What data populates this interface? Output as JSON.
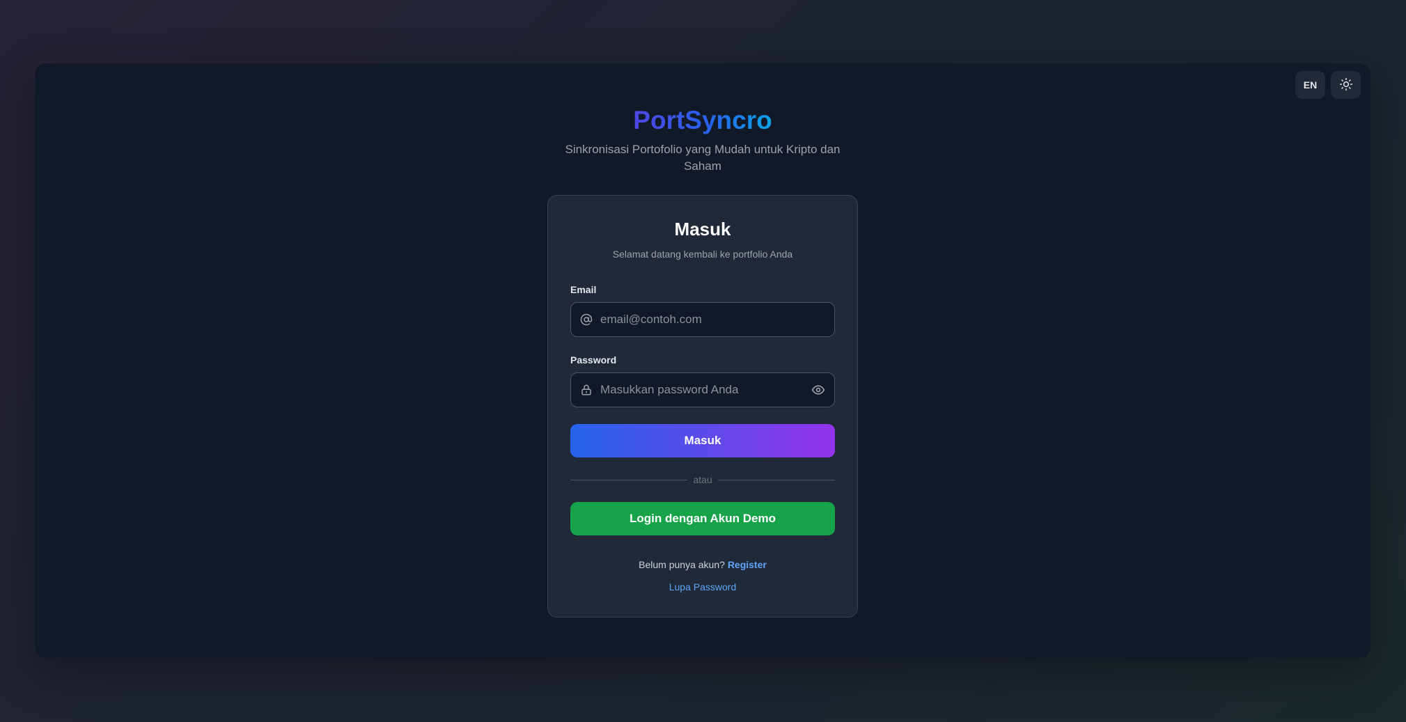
{
  "header": {
    "language_label": "EN",
    "theme_toggle_icon": "sun-icon"
  },
  "brand": {
    "title": "PortSyncro",
    "subtitle": "Sinkronisasi Portofolio yang Mudah untuk Kripto dan Saham",
    "gradient_colors": [
      "#4f46e5",
      "#2563eb",
      "#0ea5e9"
    ]
  },
  "login": {
    "title": "Masuk",
    "subtitle": "Selamat datang kembali ke portfolio Anda",
    "email": {
      "label": "Email",
      "placeholder": "email@contoh.com",
      "value": "",
      "icon": "at-sign-icon"
    },
    "password": {
      "label": "Password",
      "placeholder": "Masukkan password Anda",
      "value": "",
      "icon": "lock-icon",
      "toggle_icon": "eye-icon"
    },
    "submit_label": "Masuk",
    "divider_label": "atau",
    "demo_label": "Login dengan Akun Demo",
    "no_account_text": "Belum punya akun?",
    "register_label": "Register",
    "forgot_label": "Lupa Password"
  },
  "colors": {
    "page_background": "#111827",
    "card_background": "#1f2937",
    "primary_gradient": [
      "#2563eb",
      "#9333ea"
    ],
    "demo_button": "#16a34a",
    "link": "#60a5fa"
  }
}
